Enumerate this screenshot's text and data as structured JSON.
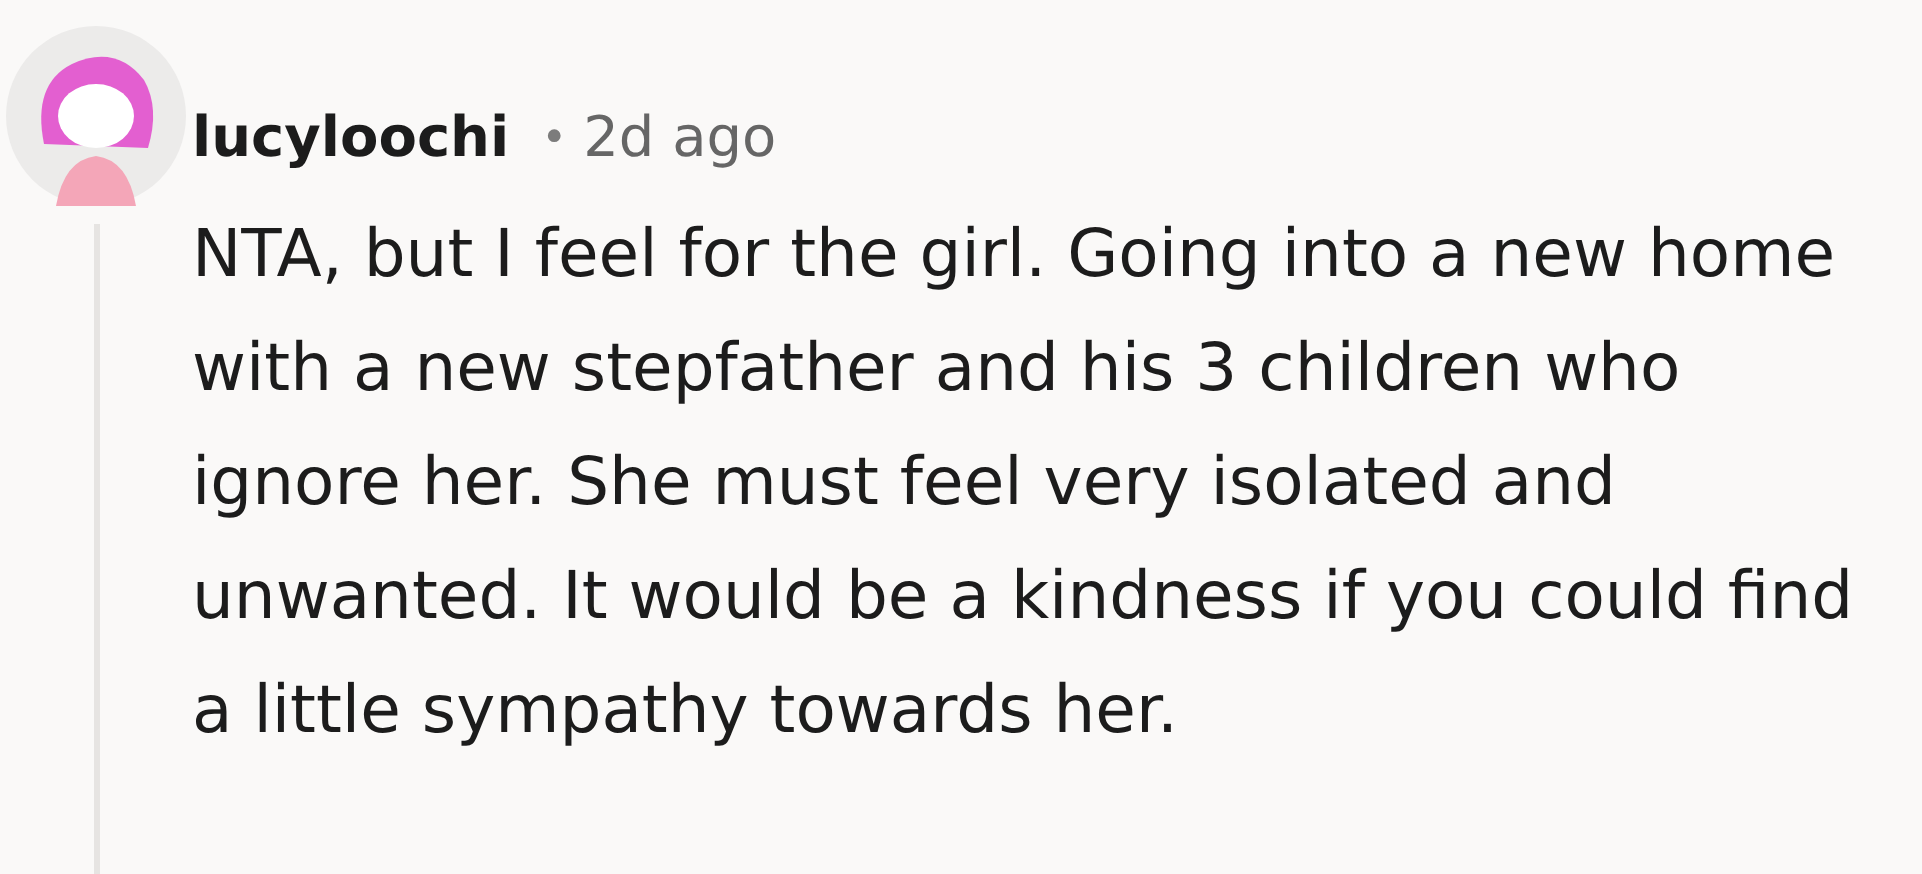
{
  "comment": {
    "username": "lucyloochi",
    "separator": "•",
    "time": "2d ago",
    "body": "NTA, but I feel for the girl. Going into a new home with a new stepfather and his 3 children who ignore her. She must feel very isolated and unwanted. It would be a kindness if you could find a little sympathy towards her."
  }
}
